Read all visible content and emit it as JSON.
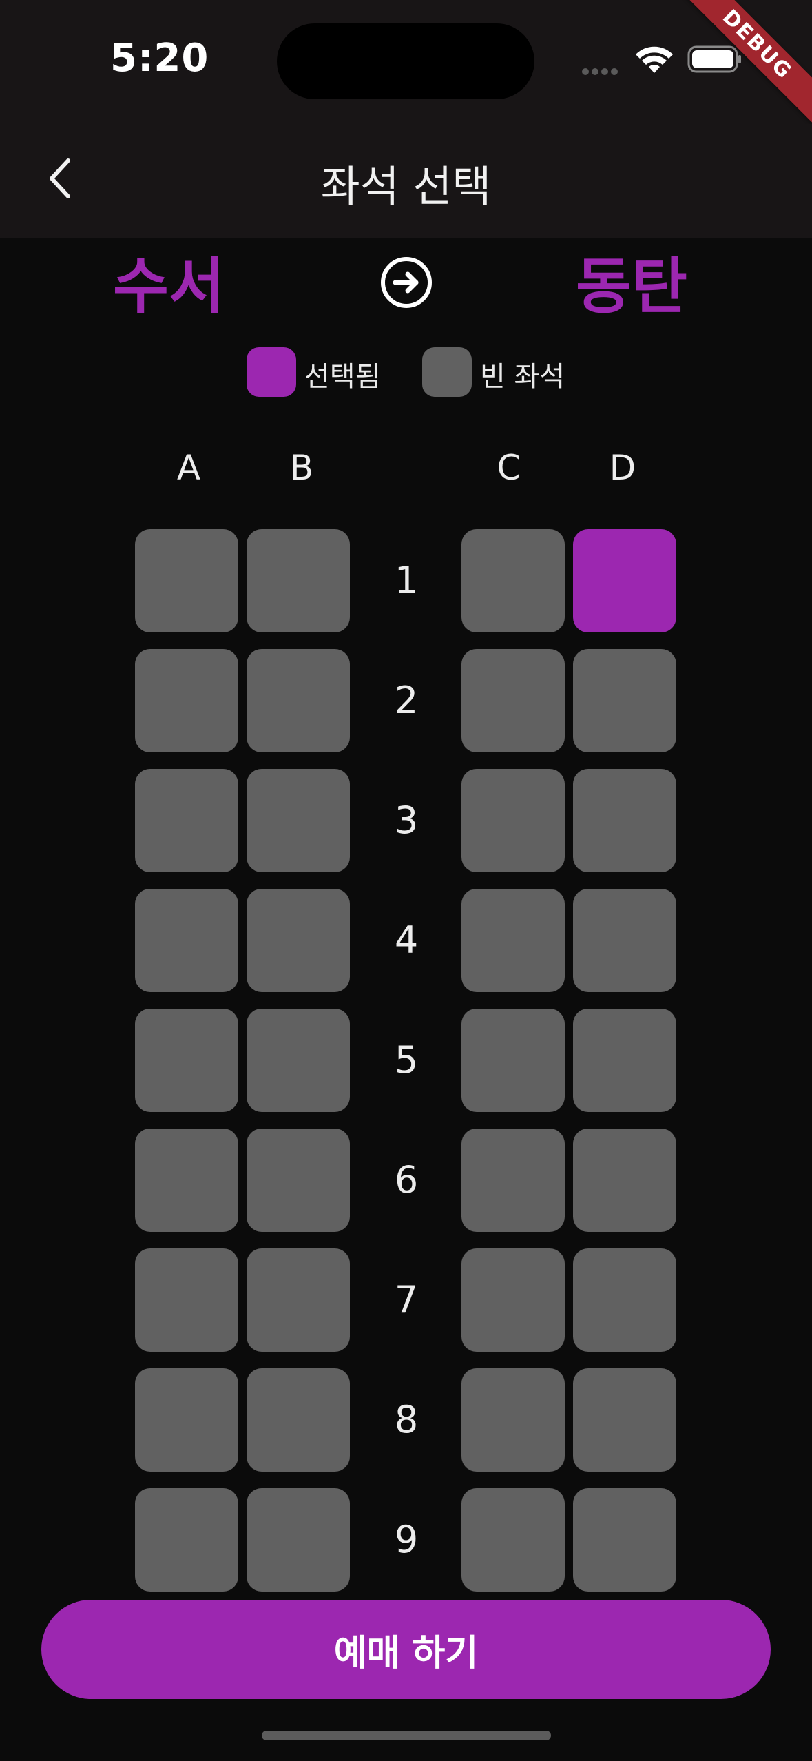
{
  "status_bar": {
    "time": "5:20",
    "debug_label": "DEBUG"
  },
  "app_bar": {
    "title": "좌석 선택",
    "back_icon": "chevron-left-icon"
  },
  "route": {
    "departure": "수서",
    "arrival": "동탄",
    "arrow_icon": "arrow-right-circle-icon"
  },
  "legend": {
    "selected_label": "선택됨",
    "empty_label": "빈 좌석"
  },
  "columns": [
    "A",
    "B",
    "C",
    "D"
  ],
  "rows": [
    "1",
    "2",
    "3",
    "4",
    "5",
    "6",
    "7",
    "8",
    "9"
  ],
  "selected_seat": {
    "row": "1",
    "col": "D"
  },
  "colors": {
    "accent": "#9c27b0",
    "seat_empty": "#616161",
    "background": "#0b0b0b",
    "app_bar": "#181516"
  },
  "book_button": {
    "label": "예매 하기"
  }
}
